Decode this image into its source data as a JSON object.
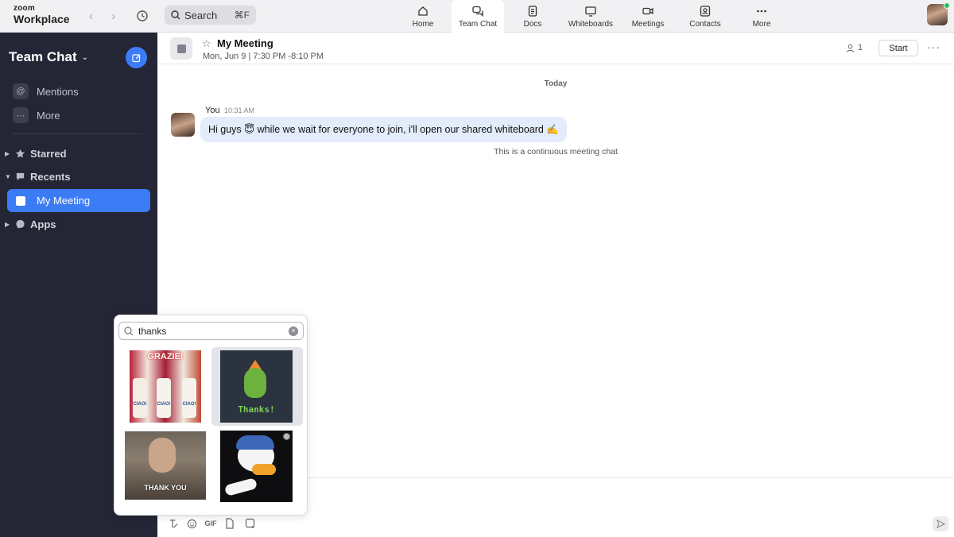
{
  "app": {
    "brand_small": "zoom",
    "brand_big": "Workplace"
  },
  "search": {
    "label": "Search",
    "shortcut": "⌘F"
  },
  "tabs": [
    {
      "label": "Home",
      "icon": "home-icon"
    },
    {
      "label": "Team Chat",
      "icon": "chat-icon",
      "active": true
    },
    {
      "label": "Docs",
      "icon": "docs-icon"
    },
    {
      "label": "Whiteboards",
      "icon": "whiteboard-icon"
    },
    {
      "label": "Meetings",
      "icon": "video-icon"
    },
    {
      "label": "Contacts",
      "icon": "contacts-icon"
    },
    {
      "label": "More",
      "icon": "more-dots-icon"
    }
  ],
  "sidebar": {
    "title": "Team Chat",
    "quick": [
      {
        "label": "Mentions",
        "icon": "at-icon"
      },
      {
        "label": "More",
        "icon": "more-dots-icon"
      }
    ],
    "sections": [
      {
        "label": "Starred",
        "icon": "star-icon"
      },
      {
        "label": "Recents",
        "icon": "chat-bubble-icon"
      },
      {
        "label": "Apps",
        "icon": "apps-icon"
      }
    ],
    "active_item": "My Meeting"
  },
  "chat": {
    "title": "My Meeting",
    "subtitle": "Mon, Jun 9  |  7:30 PM -8:10 PM",
    "member_count": "1",
    "start_label": "Start",
    "date_divider": "Today",
    "message": {
      "author": "You",
      "time": "10:31 AM",
      "text": "Hi guys 😇 while we wait for everyone to join, i'll open our shared whiteboard ✍️"
    },
    "note": "This is a continuous meeting chat"
  },
  "composer": {
    "tools": [
      "format-icon",
      "emoji-icon",
      "GIF",
      "file-icon",
      "screenshot-icon"
    ],
    "gif_label": "GIF"
  },
  "gif_picker": {
    "query": "thanks",
    "results": [
      {
        "label": "GRAZIE!",
        "sub": "CIAO!"
      },
      {
        "label": "Thanks!"
      },
      {
        "label": "THANK YOU"
      },
      {
        "label": ""
      }
    ]
  },
  "colors": {
    "accent": "#3b7cf5",
    "sidebar": "#242636",
    "bubble": "#e3ecfb"
  }
}
